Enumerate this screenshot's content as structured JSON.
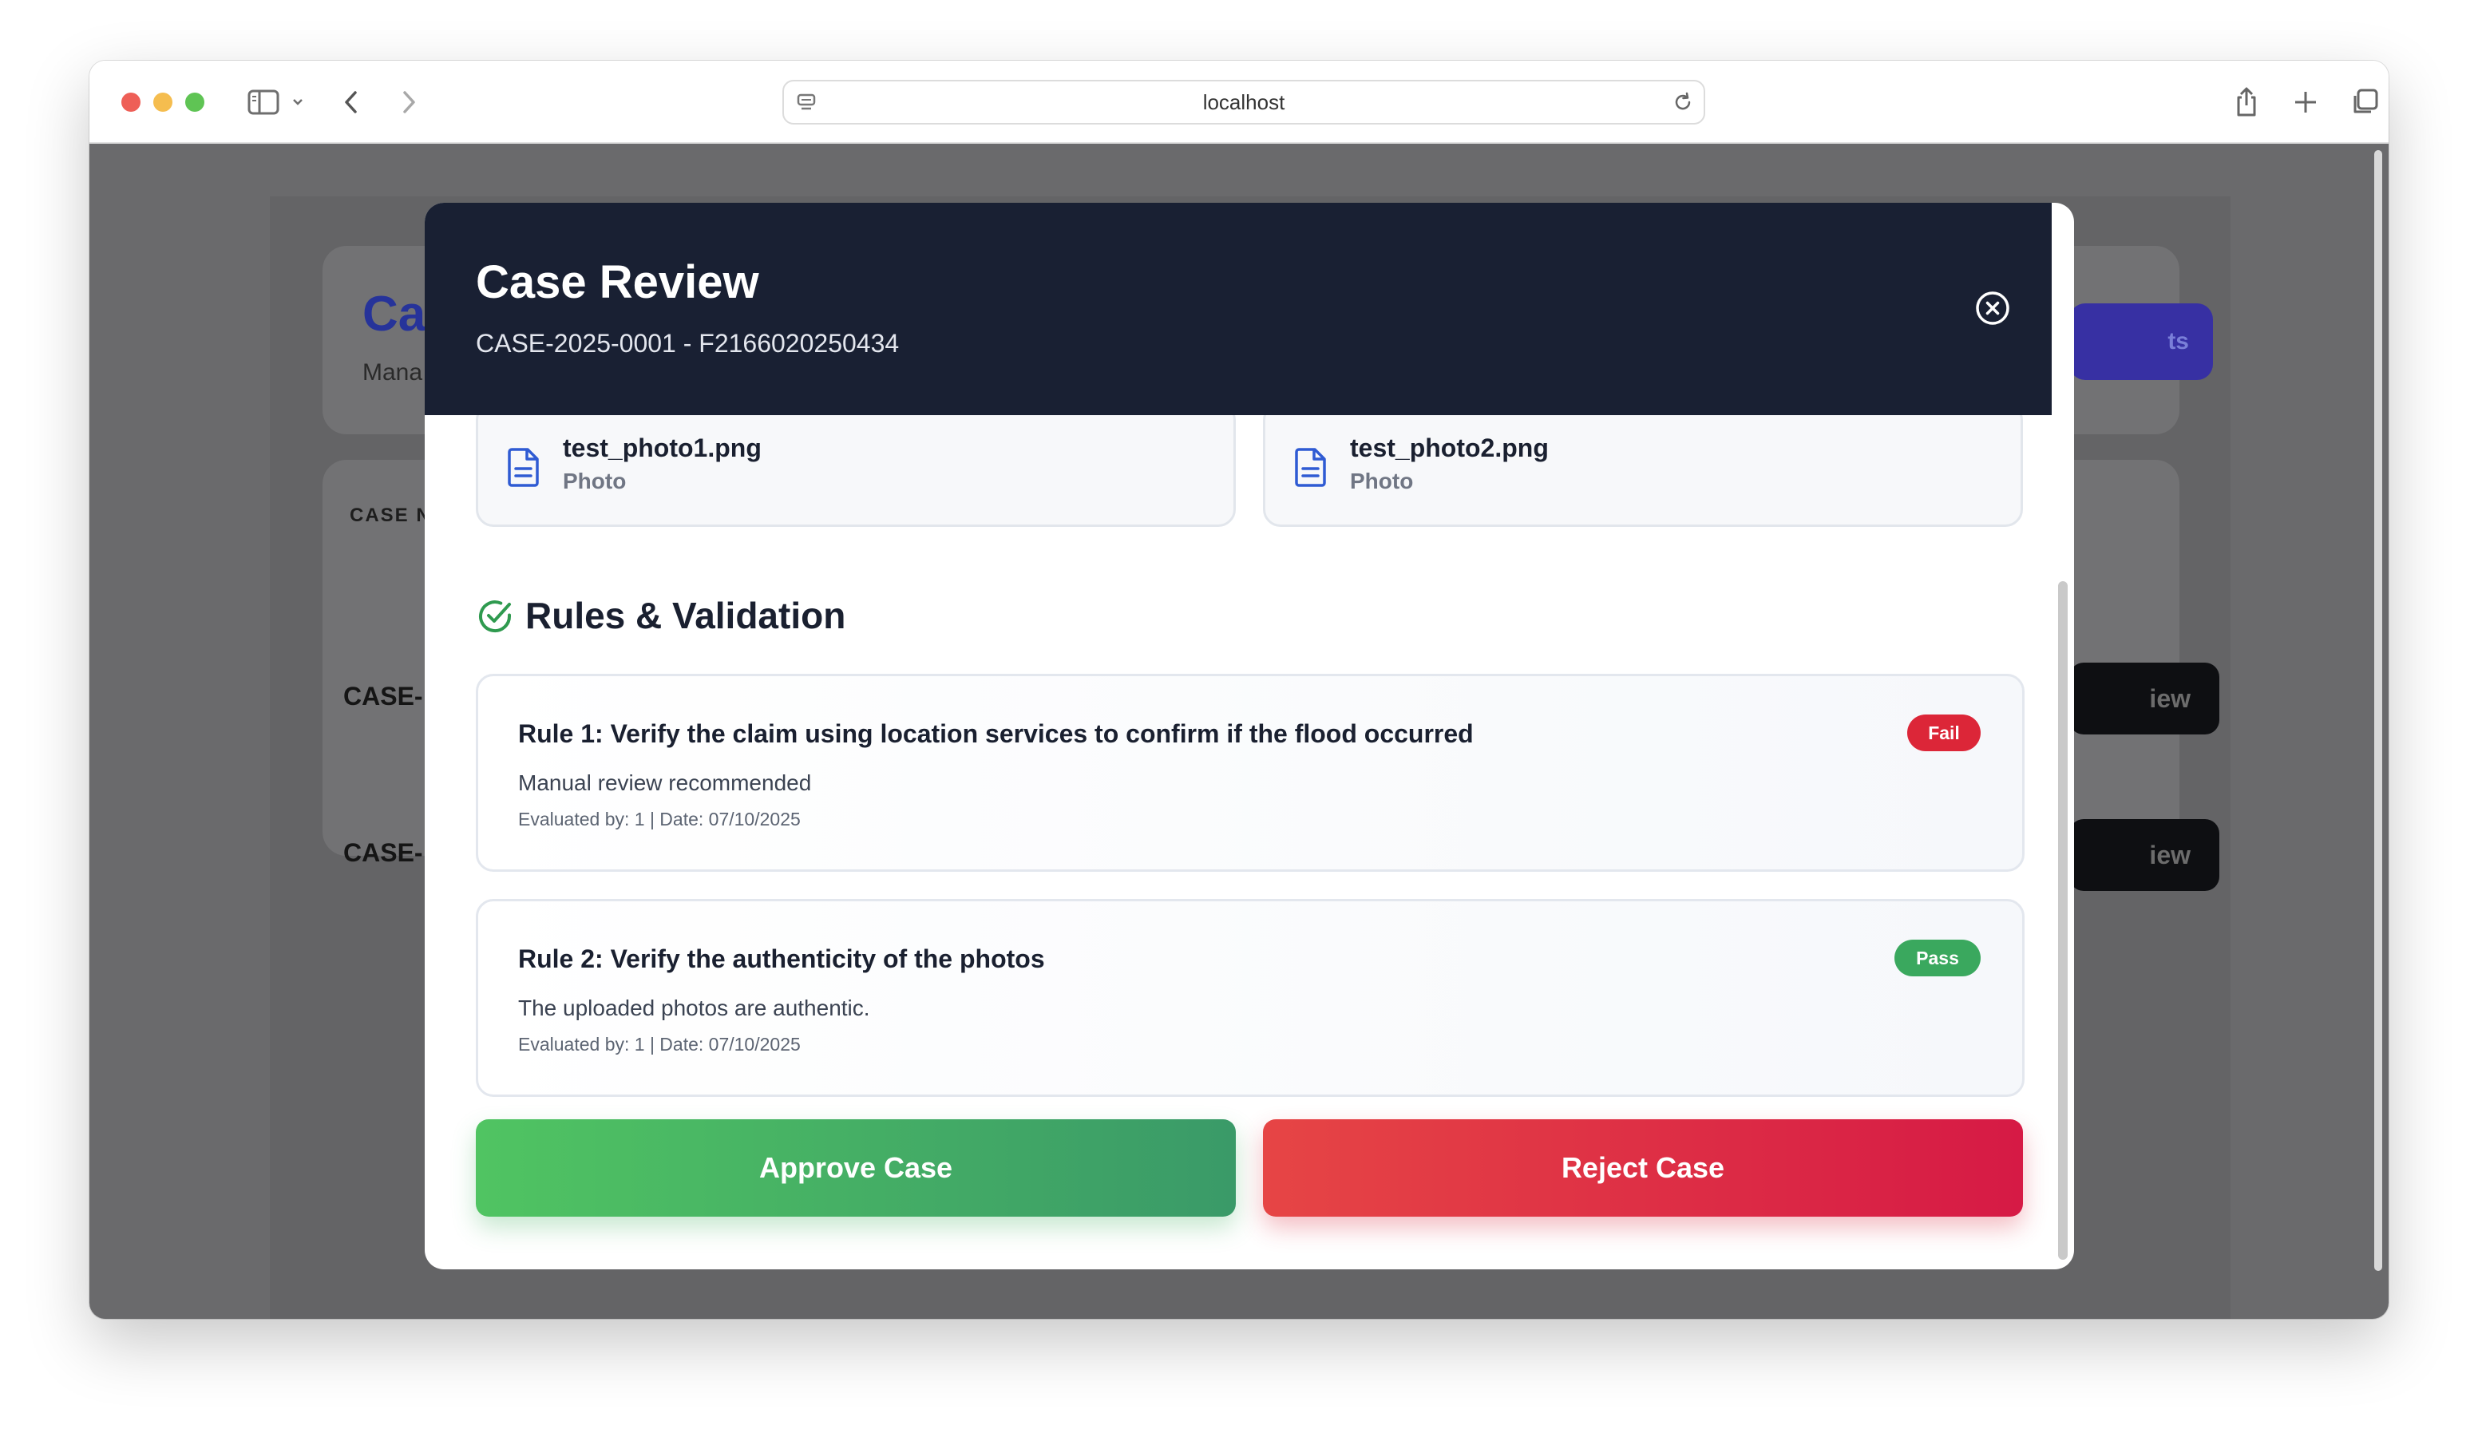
{
  "browser": {
    "url": "localhost"
  },
  "background_page": {
    "title_fragment": "Ca",
    "subtitle_fragment": "Mana",
    "header_button_fragment": "ts",
    "table_header_fragment": "CASE N",
    "rows": [
      {
        "case_fragment": "CASE-",
        "button_fragment": "iew"
      },
      {
        "case_fragment": "CASE-",
        "button_fragment": "iew"
      }
    ]
  },
  "modal": {
    "title": "Case Review",
    "subtitle": "CASE-2025-0001 - F2166020250434",
    "files": [
      {
        "name": "test_photo1.png",
        "type": "Photo",
        "icon": "document-icon"
      },
      {
        "name": "test_photo2.png",
        "type": "Photo",
        "icon": "document-icon"
      }
    ],
    "rules_section": {
      "title": "Rules & Validation",
      "icon": "check-circle-icon"
    },
    "rules": [
      {
        "title": "Rule 1: Verify the claim using location services to confirm if the flood occurred",
        "description": "Manual review recommended",
        "meta": "Evaluated by: 1 | Date: 07/10/2025",
        "status": "Fail"
      },
      {
        "title": "Rule 2: Verify the authenticity of the photos",
        "description": "The uploaded photos are authentic.",
        "meta": "Evaluated by: 1 | Date: 07/10/2025",
        "status": "Pass"
      }
    ],
    "actions": {
      "approve_label": "Approve Case",
      "reject_label": "Reject Case"
    }
  },
  "colors": {
    "header_bg": "#192033",
    "approve": "#4cbc62",
    "reject": "#dc2638",
    "pass_badge": "#3aa85e",
    "fail_badge": "#dc2638",
    "accent_blue": "#3b5bdb"
  }
}
